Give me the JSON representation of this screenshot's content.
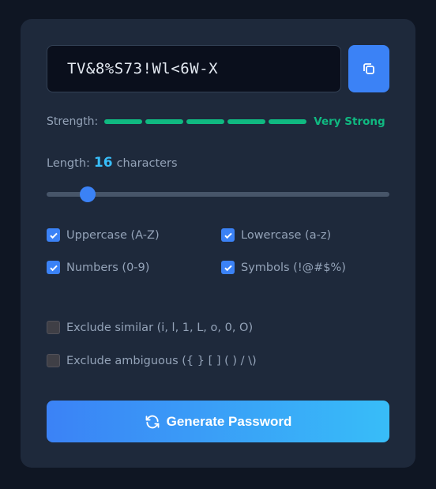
{
  "password": {
    "value": "TV&8%S73!Wl<6W-X"
  },
  "copy": {
    "icon": "copy-icon"
  },
  "strength": {
    "label": "Strength:",
    "text": "Very Strong",
    "level": 5,
    "max_level": 5,
    "color": "#10b981"
  },
  "length": {
    "label": "Length:",
    "value": "16",
    "unit": "characters",
    "slider_fraction": 0.12
  },
  "options": [
    {
      "label": "Uppercase (A-Z)",
      "checked": true
    },
    {
      "label": "Lowercase (a-z)",
      "checked": true
    },
    {
      "label": "Numbers (0-9)",
      "checked": true
    },
    {
      "label": "Symbols (!@#$%)",
      "checked": true
    }
  ],
  "excludes": [
    {
      "label": "Exclude similar (i, l, 1, L, o, 0, O)",
      "checked": false
    },
    {
      "label": "Exclude ambiguous ({ } [ ] ( ) / \\)",
      "checked": false
    }
  ],
  "generate": {
    "label": "Generate Password",
    "icon": "refresh-icon"
  },
  "colors": {
    "accent": "#3b82f6",
    "accent_end": "#38bdf8",
    "success": "#10b981"
  }
}
